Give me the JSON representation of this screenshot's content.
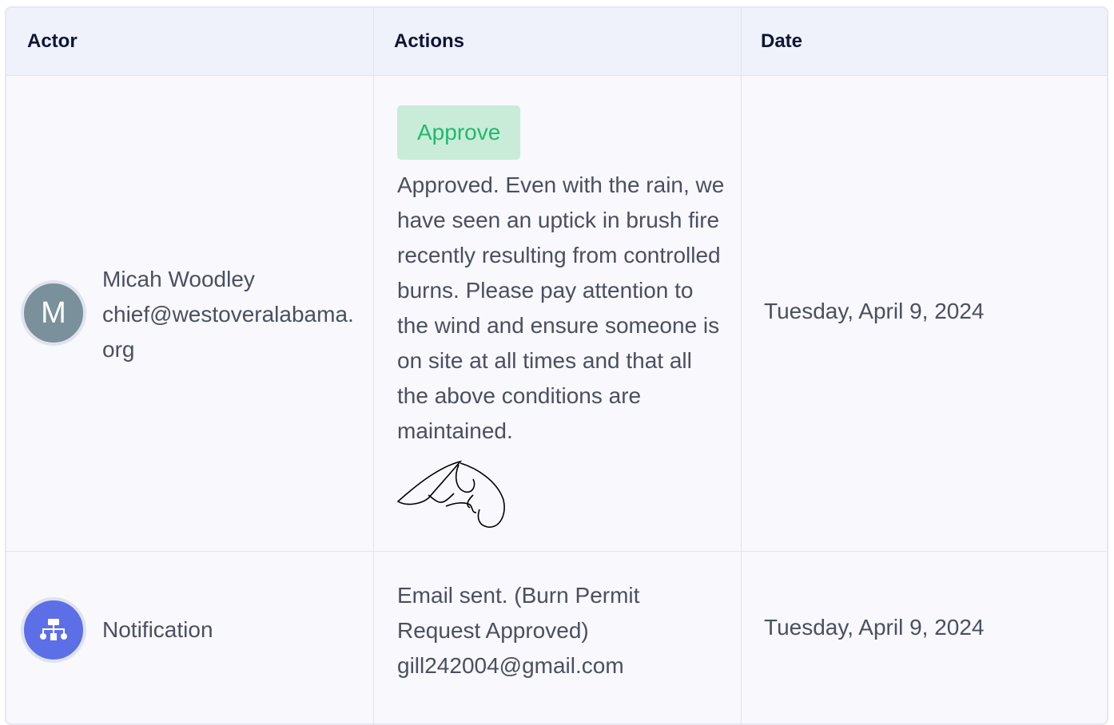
{
  "table": {
    "headers": {
      "actor": "Actor",
      "actions": "Actions",
      "date": "Date"
    },
    "rows": [
      {
        "avatar_letter": "M",
        "actor_name": "Micah Woodley",
        "actor_email": "chief@westoveralabama.org",
        "action_badge": "Approve",
        "action_text": "Approved. Even with the rain, we have seen an uptick in brush fire recently resulting from controlled burns. Please pay attention to the wind and ensure someone is on site at all times and that all the above conditions are maintained.",
        "date": "Tuesday, April 9, 2024"
      },
      {
        "avatar_icon": "sitemap-icon",
        "actor_name": "Notification",
        "action_text": "Email sent. (Burn Permit Request Approved) gill242004@gmail.com",
        "date": "Tuesday, April 9, 2024"
      }
    ]
  },
  "colors": {
    "header_bg": "#eff1fb",
    "row_bg": "#f8f8fd",
    "badge_bg": "#c9ecd9",
    "badge_text": "#1fba6b",
    "avatar_gray": "#7a909b",
    "avatar_blue": "#5d6fe6"
  }
}
